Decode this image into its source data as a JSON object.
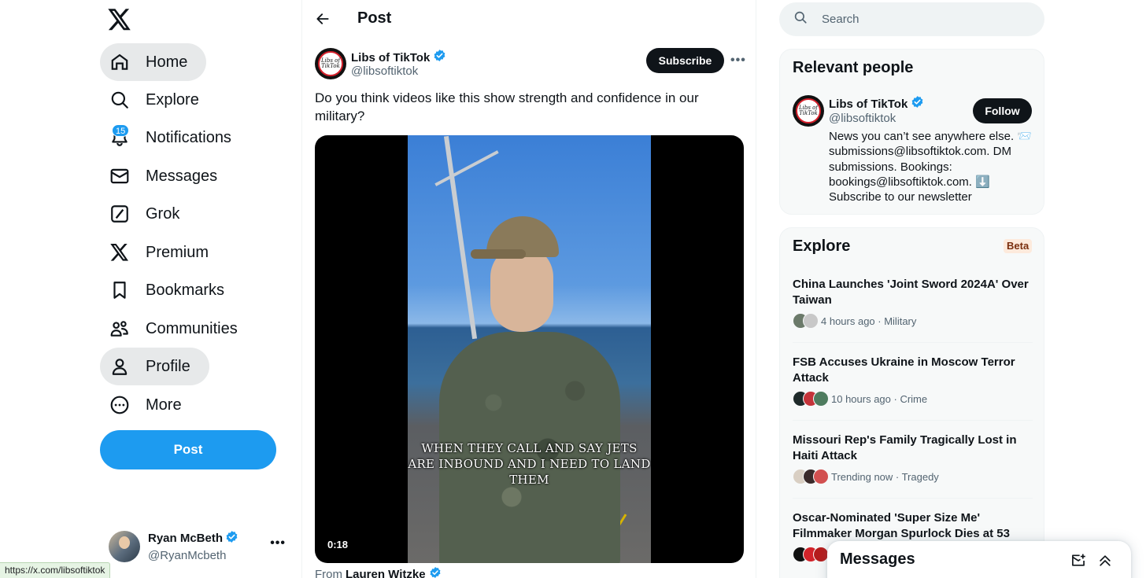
{
  "nav": {
    "items": [
      {
        "label": "Home",
        "icon": "home-icon"
      },
      {
        "label": "Explore",
        "icon": "search-icon"
      },
      {
        "label": "Notifications",
        "icon": "bell-icon"
      },
      {
        "label": "Messages",
        "icon": "envelope-icon"
      },
      {
        "label": "Grok",
        "icon": "grok-icon"
      },
      {
        "label": "Premium",
        "icon": "x-logo-icon"
      },
      {
        "label": "Bookmarks",
        "icon": "bookmark-icon"
      },
      {
        "label": "Communities",
        "icon": "communities-icon"
      },
      {
        "label": "Profile",
        "icon": "person-icon"
      },
      {
        "label": "More",
        "icon": "more-circle-icon"
      }
    ],
    "notification_count": "15",
    "post_button": "Post"
  },
  "account": {
    "name": "Ryan McBeth",
    "handle": "@RyanMcbeth"
  },
  "status_bar_url": "https://x.com/libsoftiktok",
  "post": {
    "header_title": "Post",
    "author_name": "Libs of TikTok",
    "author_handle": "@libsoftiktok",
    "avatar_text": "Libs of TikTok",
    "subscribe_label": "Subscribe",
    "text": "Do you think videos like this show strength and confidence in our military?",
    "video_caption": "WHEN THEY CALL AND SAY JETS ARE INBOUND AND I NEED TO LAND THEM",
    "video_time": "0:18",
    "from_prefix": "From",
    "from_name": "Lauren Witzke"
  },
  "search": {
    "placeholder": "Search"
  },
  "relevant_people": {
    "title": "Relevant people",
    "name": "Libs of TikTok",
    "handle": "@libsoftiktok",
    "follow_label": "Follow",
    "bio": "News you can’t see anywhere else. 📨 submissions@libsoftiktok.com. DM submissions. Bookings: bookings@libsoftiktok.com. ⬇️ Subscribe to our newsletter"
  },
  "explore": {
    "title": "Explore",
    "badge": "Beta",
    "trends": [
      {
        "title": "China Launches 'Joint Sword 2024A' Over Taiwan",
        "meta": "4 hours ago · Military"
      },
      {
        "title": "FSB Accuses Ukraine in Moscow Terror Attack",
        "meta": "10 hours ago · Crime"
      },
      {
        "title": "Missouri Rep's Family Tragically Lost in Haiti Attack",
        "meta": "Trending now · Tragedy"
      },
      {
        "title": "Oscar-Nominated 'Super Size Me' Filmmaker Morgan Spurlock Dies at 53",
        "meta": ""
      }
    ]
  },
  "messages_drawer": {
    "title": "Messages"
  },
  "colors": {
    "accent": "#1d9bf0",
    "text": "#0f1419",
    "secondary_text": "#536471",
    "verified": "#1d9bf0",
    "beta_bg": "#fdeadc",
    "beta_text": "#7a2e0e"
  }
}
